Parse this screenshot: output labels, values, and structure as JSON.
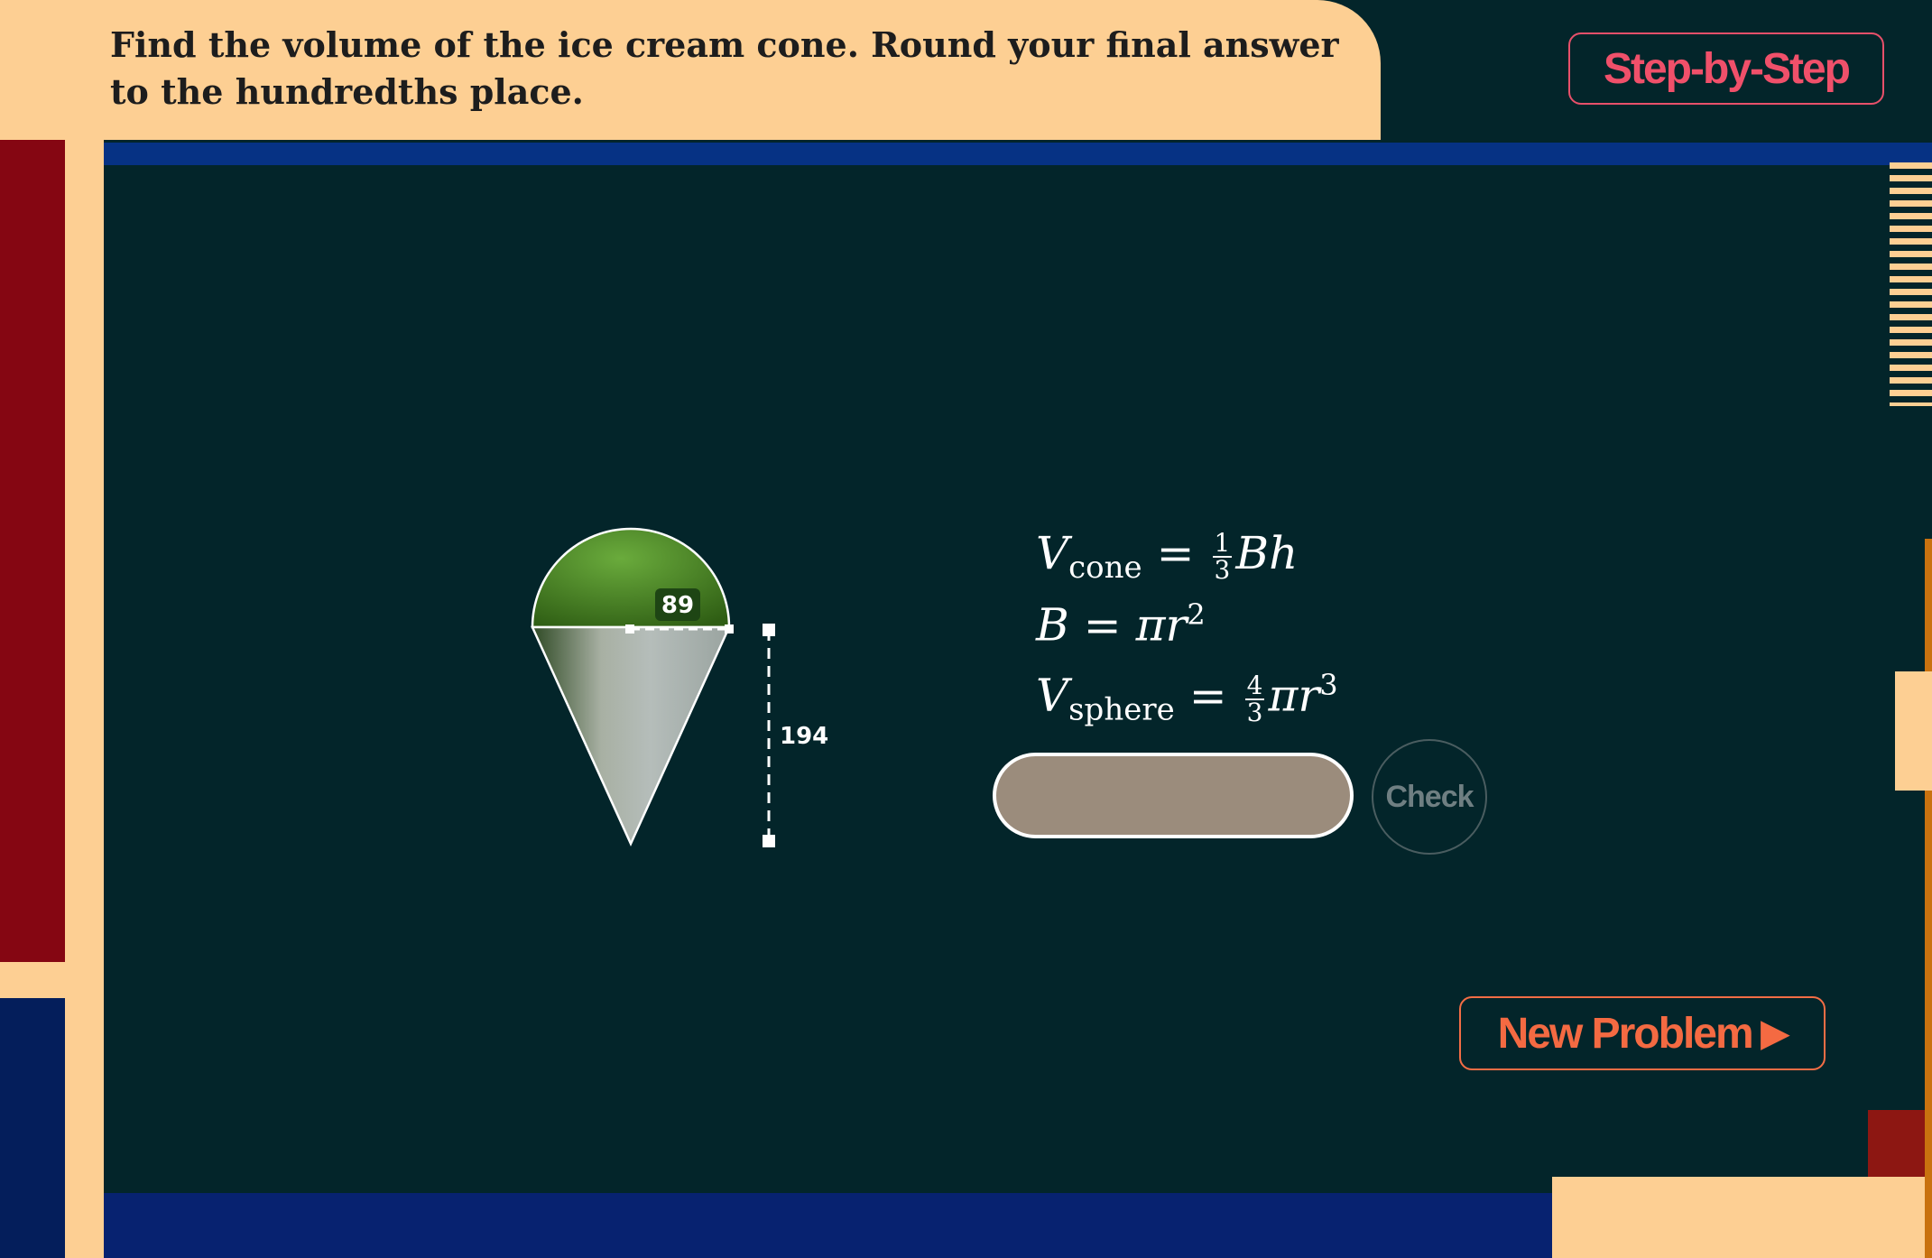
{
  "question": {
    "text": "Find the volume of the ice cream cone. Round your final answer to the hundredths place."
  },
  "buttons": {
    "step_by_step": "Step-by-Step",
    "check": "Check",
    "new_problem": "New Problem"
  },
  "figure": {
    "diameter_label": "89",
    "height_label": "194",
    "scoop_color": "#4d8b2a",
    "cone_color": "#a9b2ad"
  },
  "formulas": {
    "cone_v": "V",
    "cone_sub": "cone",
    "cone_frac_num": "1",
    "cone_frac_den": "3",
    "cone_rhs": "Bh",
    "base_lhs": "B",
    "base_rhs": "πr",
    "base_exp": "2",
    "sphere_v": "V",
    "sphere_sub": "sphere",
    "sphere_frac_num": "4",
    "sphere_frac_den": "3",
    "sphere_rhs": "πr",
    "sphere_exp": "3",
    "equals": "="
  },
  "answer": {
    "value": "",
    "placeholder": ""
  },
  "colors": {
    "board": "#03252a",
    "cream": "#fdcf93",
    "accent_pink": "#f0506a",
    "accent_orange": "#f46a42"
  }
}
